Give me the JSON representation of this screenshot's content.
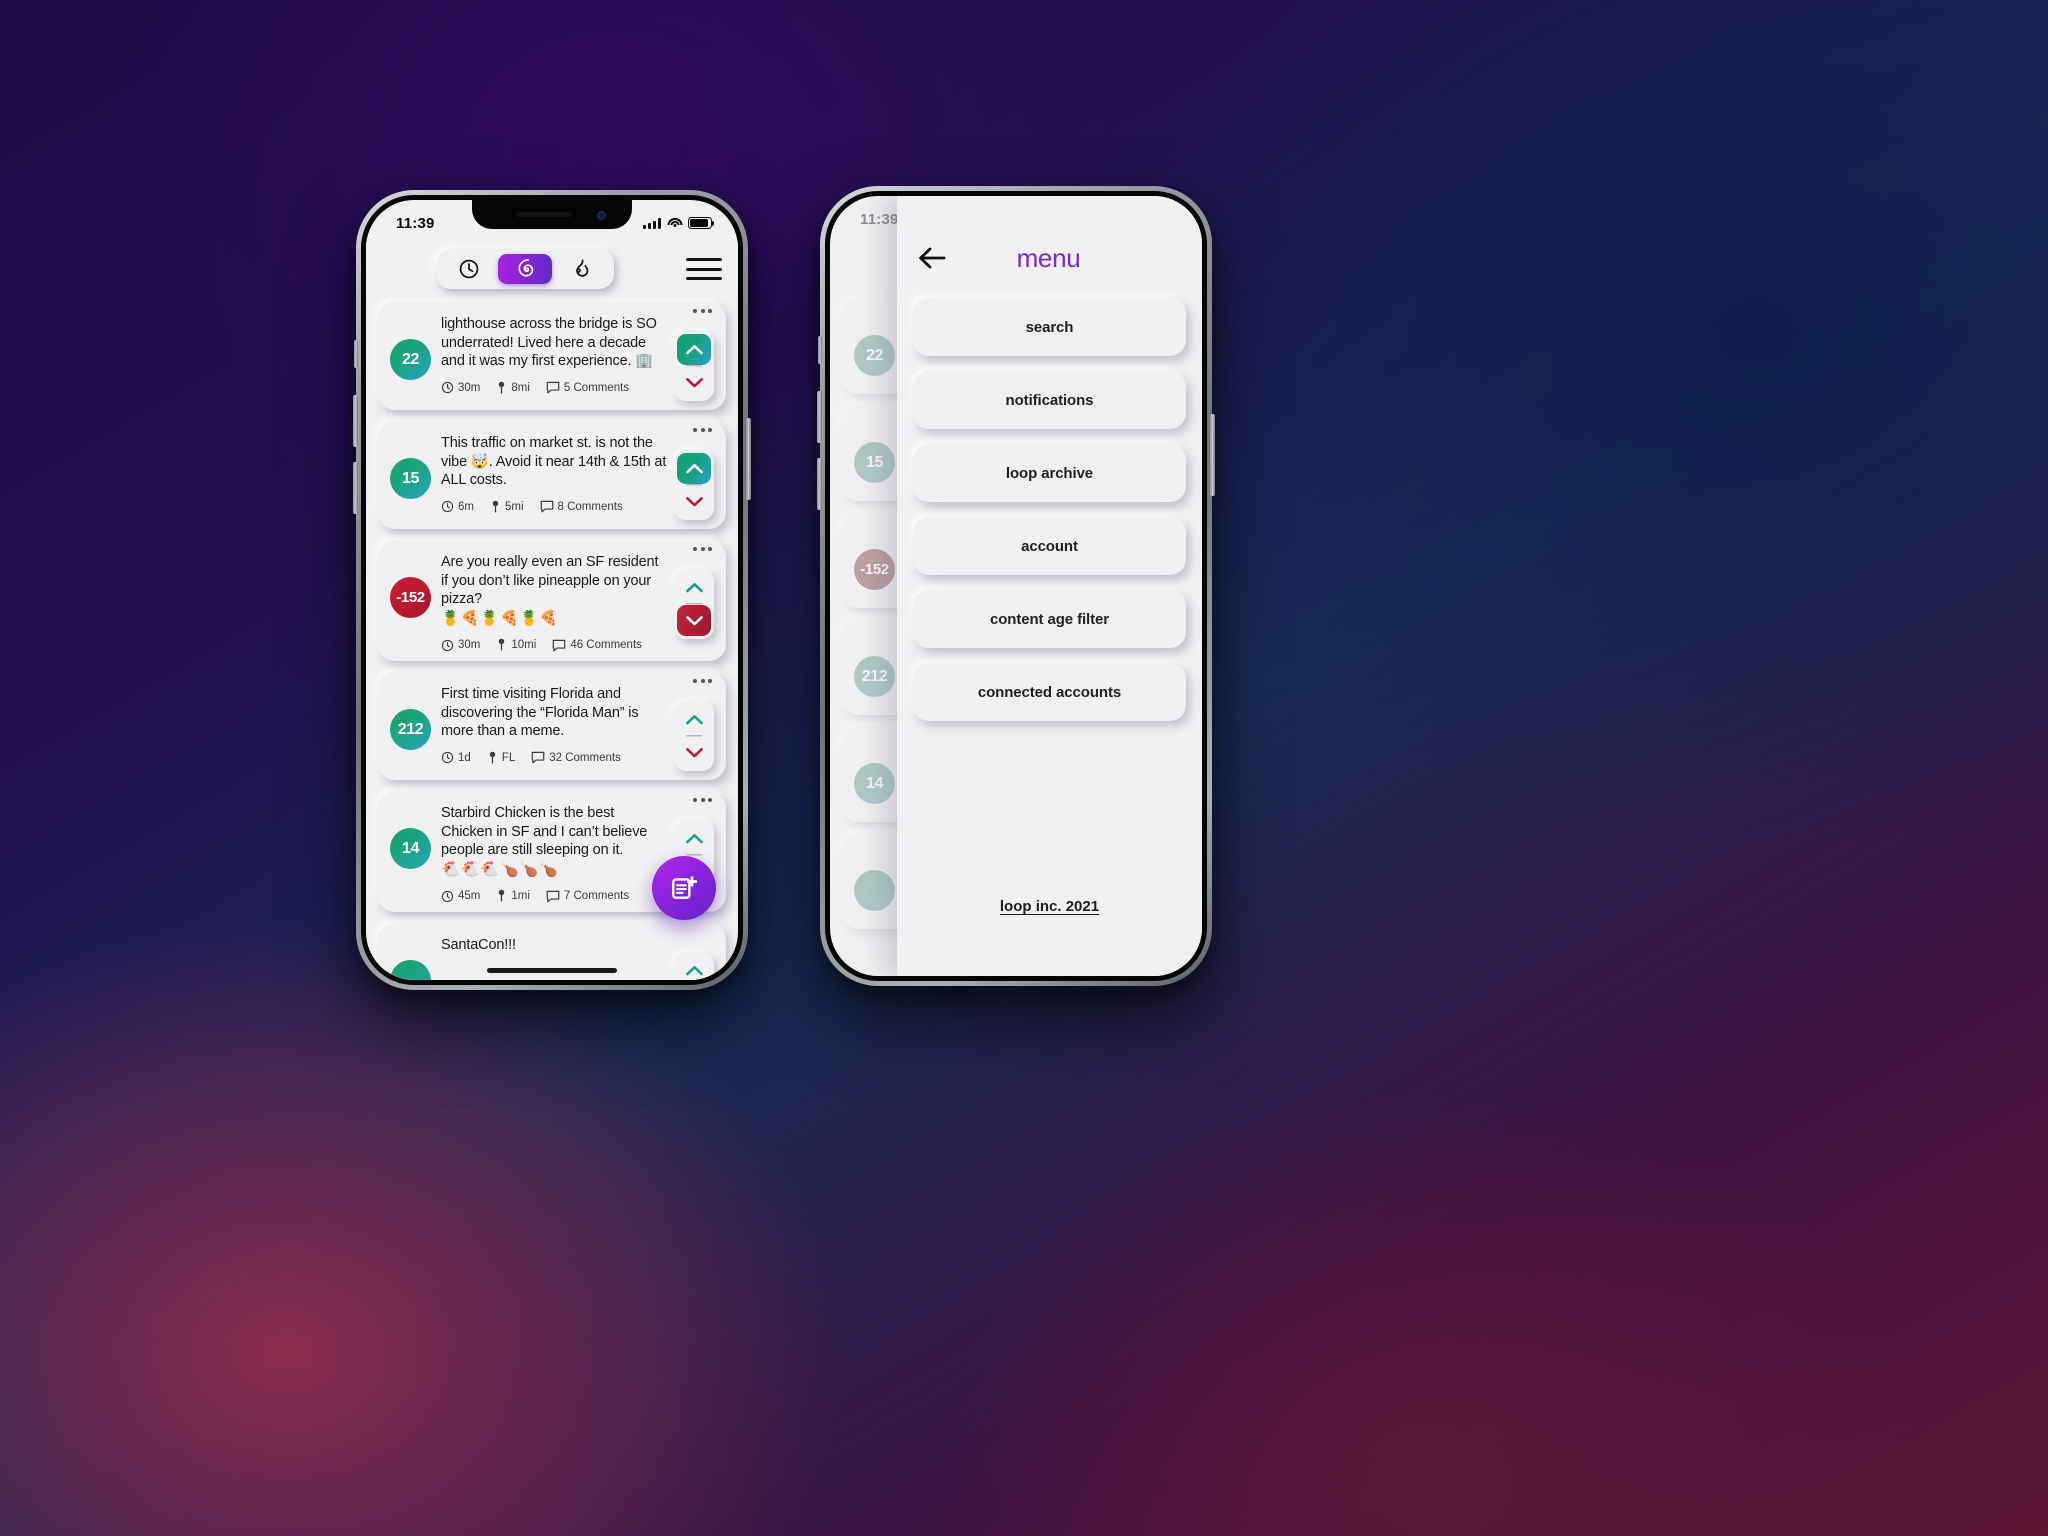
{
  "status": {
    "time": "11:39"
  },
  "feed_phone": {
    "toolbar": {
      "tabs": [
        {
          "id": "recent",
          "icon": "clock-icon",
          "active": false
        },
        {
          "id": "loop",
          "icon": "spiral-icon",
          "active": true
        },
        {
          "id": "hot",
          "icon": "flame-icon",
          "active": false
        }
      ],
      "menu_button": "hamburger-icon"
    },
    "fab": {
      "icon": "compose-post-icon",
      "color": "#8d23dd"
    },
    "posts": [
      {
        "score": "22",
        "score_state": "positive",
        "text": "lighthouse across the bridge is SO underrated! Lived here a decade and it was my first experience. 🏢",
        "emoji": "",
        "time": "30m",
        "distance": "8mi",
        "comments": "5 Comments",
        "vote": "up"
      },
      {
        "score": "15",
        "score_state": "positive",
        "text": "This traffic on market st. is not the vibe 🤯. Avoid it near 14th & 15th at ALL costs.",
        "emoji": "",
        "time": "6m",
        "distance": "5mi",
        "comments": "8 Comments",
        "vote": "up"
      },
      {
        "score": "-152",
        "score_state": "negative",
        "text": "Are you really even an SF resident if you don’t like pineapple on your pizza?",
        "emoji": "🍍🍕🍍🍕🍍🍕",
        "time": "30m",
        "distance": "10mi",
        "comments": "46 Comments",
        "vote": "down"
      },
      {
        "score": "212",
        "score_state": "positive",
        "text": "First time visiting Florida and discovering the “Florida Man” is more than a meme.",
        "emoji": "",
        "time": "1d",
        "distance": "FL",
        "comments": "32 Comments",
        "vote": "none"
      },
      {
        "score": "14",
        "score_state": "positive",
        "text": "Starbird Chicken is the best Chicken in SF and I can’t believe people are still sleeping on it.",
        "emoji": "🐔🐔🐔🍗🍗🍗",
        "time": "45m",
        "distance": "1mi",
        "comments": "7 Comments",
        "vote": "none"
      },
      {
        "score": "",
        "score_state": "positive",
        "text": "SantaCon!!!",
        "emoji": "",
        "time": "",
        "distance": "",
        "comments": "",
        "vote": "none"
      }
    ]
  },
  "menu_phone": {
    "header": {
      "back_icon": "back-arrow-icon",
      "title": "menu",
      "title_color": "#7b28cf"
    },
    "items": [
      {
        "label": "search"
      },
      {
        "label": "notifications"
      },
      {
        "label": "loop archive"
      },
      {
        "label": "account"
      },
      {
        "label": "content age filter"
      },
      {
        "label": "connected accounts"
      }
    ],
    "footer": {
      "label": "loop inc. 2021"
    }
  }
}
